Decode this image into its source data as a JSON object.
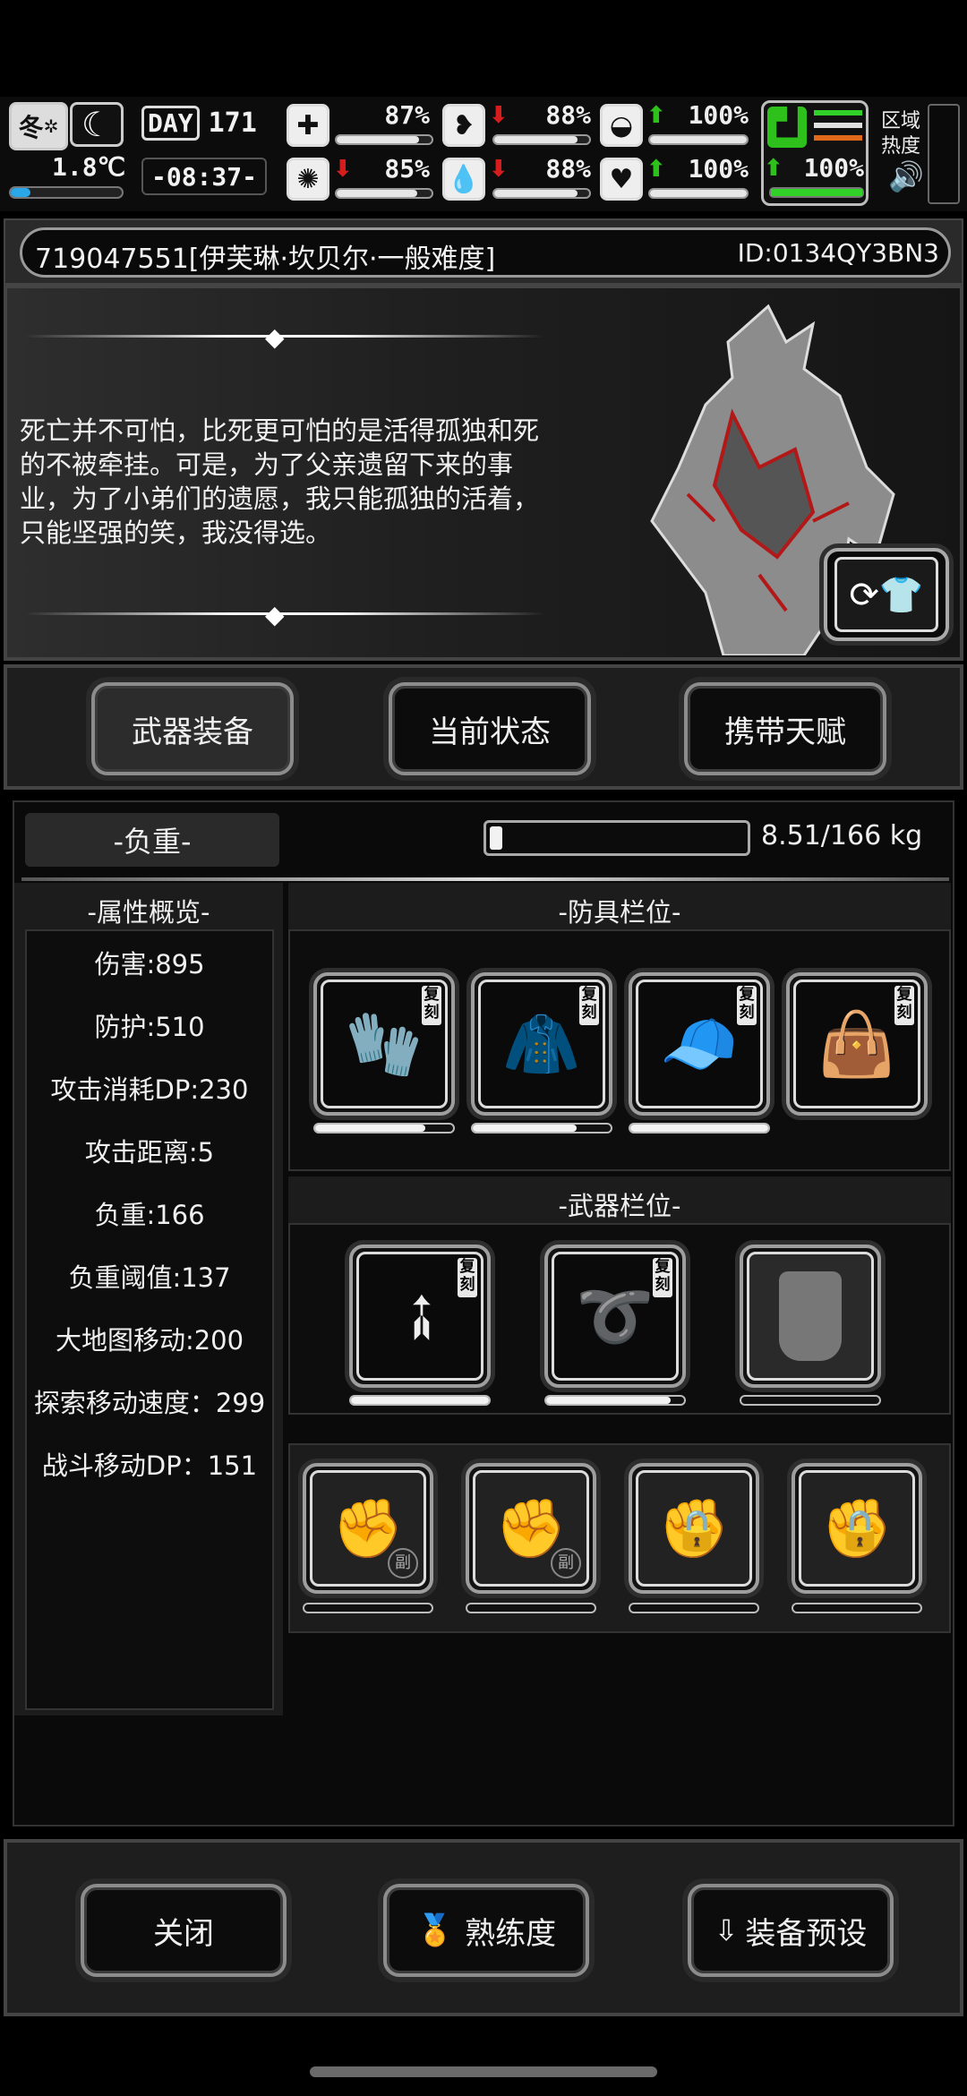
{
  "hud": {
    "season": "冬",
    "temperature": "1.8℃",
    "day_label": "DAY",
    "day_number": "171",
    "clock": "-08:37-",
    "health_pct": "87%",
    "hunger_pct": "88%",
    "armor_pct": "100%",
    "sanity_pct": "85%",
    "thirst_pct": "88%",
    "mood_pct": "100%",
    "stamina_pct": "100%",
    "health_level": 0.87,
    "hunger_level": 0.88,
    "armor_level": 1.0,
    "sanity_level": 0.85,
    "thirst_level": 0.88,
    "mood_level": 1.0,
    "stamina_level": 1.0,
    "temperature_level": 0.18,
    "region_label_1": "区域",
    "region_label_2": "热度",
    "icons": {
      "season": "snowflake-icon",
      "weather": "moon-icon",
      "health": "first-aid-icon",
      "hunger": "stomach-icon",
      "armor": "helmet-icon",
      "sanity": "brain-icon",
      "thirst": "water-drop-icon",
      "mood": "heart-icon",
      "stamina": "boot-icon",
      "sound": "speaker-icon"
    }
  },
  "character": {
    "name_line": "719047551[伊芙琳·坎贝尔·一般难度]",
    "id_line": "ID:0134QY3BN3",
    "quote": "死亡并不可怕，比死更可怕的是活得孤独和死的不被牵挂。可是，为了父亲遗留下来的事业，为了小弟们的遗愿，我只能孤独的活着，只能坚强的笑，我没得选。"
  },
  "tabs": [
    {
      "label": "武器装备",
      "selected": true
    },
    {
      "label": "当前状态",
      "selected": false
    },
    {
      "label": "携带天赋",
      "selected": false
    }
  ],
  "weight": {
    "title": "-负重-",
    "value": "8.51/166 kg",
    "fill_level": 0.05
  },
  "stats": {
    "title": "-属性概览-",
    "items": [
      "伤害:895",
      "防护:510",
      "攻击消耗DP:230",
      "攻击距离:5",
      "负重:166",
      "负重阈值:137",
      "大地图移动:200",
      "探索移动速度：299",
      "战斗移动DP：151"
    ]
  },
  "armor_slots": {
    "title": "-防具栏位-",
    "items": [
      {
        "icon": "gloves-icon",
        "tag": "复刻",
        "durability": 0.8
      },
      {
        "icon": "coat-icon",
        "tag": "复刻",
        "durability": 0.75
      },
      {
        "icon": "cap-icon",
        "tag": "复刻",
        "durability": 1.0
      },
      {
        "icon": "bag-icon",
        "tag": "复刻",
        "durability": 0
      }
    ]
  },
  "weapon_slots": {
    "title": "-武器栏位-",
    "items": [
      {
        "icon": "spear-icon",
        "tag": "复刻",
        "durability": 1.0
      },
      {
        "icon": "chain-whip-icon",
        "tag": "复刻",
        "durability": 0.9
      },
      {
        "icon": "riot-shield-icon",
        "tag": "",
        "durability": 0
      }
    ]
  },
  "secondary_slots": [
    {
      "icon": "fist-icon",
      "badge": "副",
      "locked": false
    },
    {
      "icon": "fist-icon",
      "badge": "副",
      "locked": false
    },
    {
      "icon": "fist-icon",
      "badge": "",
      "locked": true
    },
    {
      "icon": "fist-icon",
      "badge": "",
      "locked": true
    }
  ],
  "footer": {
    "close": "关闭",
    "proficiency": "熟练度",
    "preset": "装备预设"
  },
  "colors": {
    "up_arrow": "#2ec11c",
    "down_arrow": "#d51d1d",
    "stamina_bar": "#31d12a",
    "temp_bar": "#2aa7e8"
  }
}
